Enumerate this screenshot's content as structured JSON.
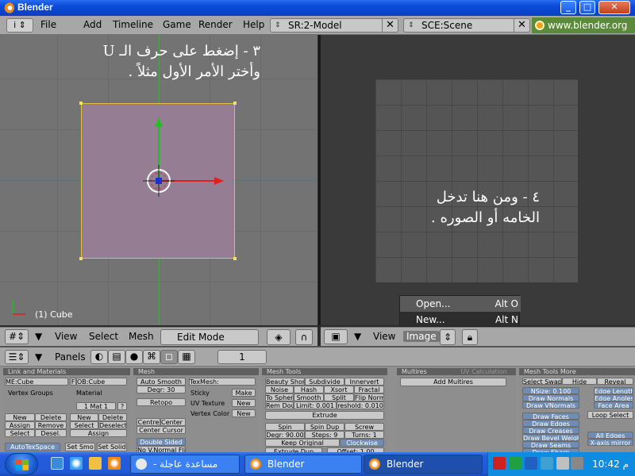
{
  "window": {
    "title": "Blender"
  },
  "menu": [
    "File",
    "Add",
    "Timeline",
    "Game",
    "Render",
    "Help"
  ],
  "screen_field": "SR:2-Model",
  "scene_field": "SCE:Scene",
  "url": "www.blender.org 2",
  "left_view": {
    "annotation_line1": "٣ - إضغط على حرف الـ U",
    "annotation_line2": "وأختر الأمر الأول مثلاً .",
    "object_label": "(1) Cube",
    "header": {
      "view": "View",
      "select": "Select",
      "mesh": "Mesh",
      "mode": "Edit Mode"
    }
  },
  "right_view": {
    "annotation_line1": "٤ - ومن هنا تدخل",
    "annotation_line2": "الخامه أو الصوره .",
    "popup": [
      {
        "label": "Open...",
        "shortcut": "Alt O"
      },
      {
        "label": "New...",
        "shortcut": "Alt N"
      }
    ],
    "header": {
      "view": "View",
      "image": "Image"
    }
  },
  "buttons_window": {
    "panels_label": "Panels",
    "frame": "1",
    "link_materials": {
      "title": "Link and Materials",
      "me": "ME:Cube",
      "f": "F",
      "ob": "OB:Cube",
      "vertex_groups": "Vertex Groups",
      "material": "Material",
      "mat": "1 Mat 1",
      "q": "?",
      "new1": "New",
      "delete1": "Delete",
      "assign1": "Assign",
      "remove": "Remove",
      "select1": "Select",
      "desel": "Desel.",
      "new2": "New",
      "delete2": "Delete",
      "select2": "Select",
      "deselect": "Deselect",
      "assign2": "Assign",
      "autotex": "AutoTexSpace",
      "set_smo": "Set Smo",
      "set_solid": "Set Solid"
    },
    "mesh": {
      "title": "Mesh",
      "auto_smooth": "Auto Smooth",
      "degr": "Degr: 30",
      "retopo": "Retopo",
      "centre": "Centre",
      "center_new": "Center Ne",
      "center_cursor": "Center Cursor",
      "double_sided": "Double Sided",
      "no_v_normal": "No V.Normal Fli",
      "texmesh": "TexMesh:",
      "sticky": "Sticky",
      "make": "Make",
      "uv_texture": "UV Texture",
      "new_uv": "New",
      "vertex_color": "Vertex Color",
      "new_vc": "New"
    },
    "mesh_tools": {
      "title": "Mesh Tools",
      "beauty_short": "Beauty Short",
      "subdivide": "Subdivide",
      "innervert": "Innervert",
      "noise": "Noise",
      "hash": "Hash",
      "xsort": "Xsort",
      "fractal": "Fractal",
      "to_sphere": "To Spher",
      "smooth": "Smooth",
      "split": "Split",
      "flip_norm": "Flip Norm",
      "rem_dou": "Rem Dou",
      "limit": "Limit: 0.001",
      "threshold": "reshold: 0.010",
      "extrude": "Extrude",
      "spin": "Spin",
      "spin_dup": "Spin Dup",
      "screw": "Screw",
      "degr": "Degr: 90.00",
      "steps": "Steps: 9",
      "turns": "Turns: 1",
      "keep_original": "Keep Original",
      "clockwise": "Clockwise",
      "extrude_dup": "Extrude Dup",
      "offset": "Offset: 1.00"
    },
    "multires": {
      "title": "Multires",
      "tab2": "UV Calculation",
      "add_multires": "Add Multires"
    },
    "mesh_tools_more": {
      "title": "Mesh Tools More",
      "select_swap": "Select Swap",
      "hide": "Hide",
      "reveal": "Reveal",
      "nsize": "NSize: 0.100",
      "draw_normals": "Draw Normals",
      "draw_vnormals": "Draw VNormals",
      "edge_length": "Edge Length",
      "edge_angles": "Edge Angles",
      "face_area": "Face Area",
      "draw_faces": "Draw Faces",
      "draw_edges": "Draw Edges",
      "draw_creases": "Draw Creases",
      "draw_bevel": "Draw Bevel Weigh",
      "draw_seams": "Draw Seams",
      "draw_sharp": "Draw Sharp",
      "loop_select": "Loop Select",
      "all_edges": "All Edges",
      "x_axis_mirror": "X-axis mirror"
    }
  },
  "taskbar": {
    "tasks": [
      {
        "label": "مساعدة عاجلة - الم...",
        "active": false
      },
      {
        "label": "Blender",
        "active": false
      },
      {
        "label": "Blender",
        "active": true
      }
    ],
    "clock": "10:42 م"
  }
}
